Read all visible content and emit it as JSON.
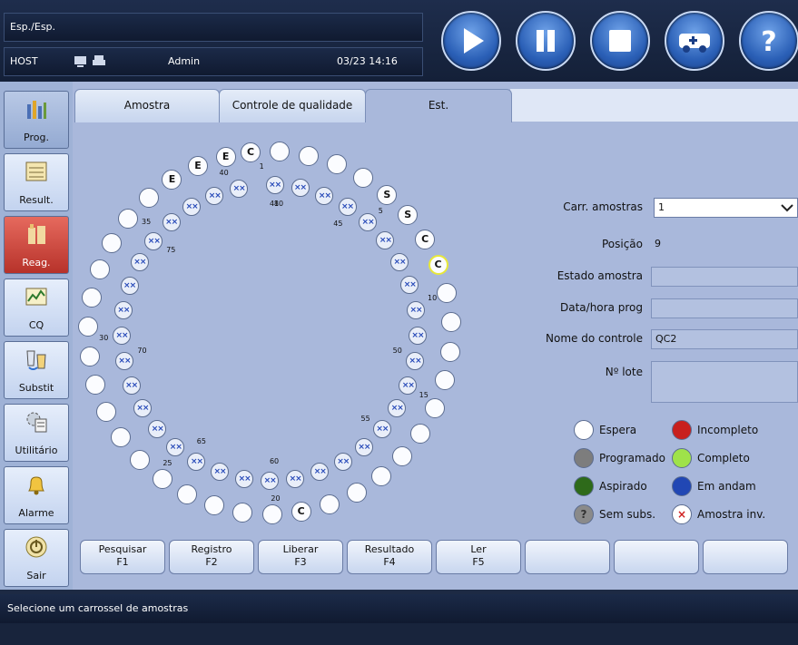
{
  "header": {
    "mode": "Esp./Esp.",
    "host": "HOST",
    "user": "Admin",
    "datetime": "03/23 14:16"
  },
  "toolbar": {
    "buttons": [
      "play-icon",
      "pause-icon",
      "stop-icon",
      "ambulance-icon",
      "help-icon"
    ]
  },
  "nav": {
    "items": [
      {
        "label": "Prog.",
        "icon": "bar-chart-icon"
      },
      {
        "label": "Result.",
        "icon": "results-sheet-icon"
      },
      {
        "label": "Reag.",
        "icon": "reagent-bottle-icon"
      },
      {
        "label": "CQ",
        "icon": "qc-graph-icon"
      },
      {
        "label": "Substit",
        "icon": "substitute-cup-icon"
      },
      {
        "label": "Utilitário",
        "icon": "utility-gear-icon"
      },
      {
        "label": "Alarme",
        "icon": "alarm-bell-icon"
      },
      {
        "label": "Sair",
        "icon": "power-icon"
      }
    ]
  },
  "tabs": [
    "Amostra",
    "Controle de qualidade",
    "Est."
  ],
  "carousel": {
    "outer": [
      {
        "text": "C",
        "hl": false
      },
      {
        "text": "",
        "hl": false
      },
      {
        "text": "",
        "hl": false
      },
      {
        "text": "",
        "hl": false
      },
      {
        "text": "",
        "hl": false
      },
      {
        "text": "S",
        "hl": false
      },
      {
        "text": "S",
        "hl": false
      },
      {
        "text": "C",
        "hl": false
      },
      {
        "text": "C",
        "hl": true
      },
      {
        "text": "",
        "hl": false
      },
      {
        "text": "",
        "hl": false
      },
      {
        "text": "",
        "hl": false
      },
      {
        "text": "",
        "hl": false
      },
      {
        "text": "",
        "hl": false
      },
      {
        "text": "",
        "hl": false
      },
      {
        "text": "",
        "hl": false
      },
      {
        "text": "",
        "hl": false
      },
      {
        "text": "",
        "hl": false
      },
      {
        "text": "",
        "hl": false
      },
      {
        "text": "C",
        "hl": false
      },
      {
        "text": "",
        "hl": false
      },
      {
        "text": "",
        "hl": false
      },
      {
        "text": "",
        "hl": false
      },
      {
        "text": "",
        "hl": false
      },
      {
        "text": "",
        "hl": false
      },
      {
        "text": "",
        "hl": false
      },
      {
        "text": "",
        "hl": false
      },
      {
        "text": "",
        "hl": false
      },
      {
        "text": "",
        "hl": false
      },
      {
        "text": "",
        "hl": false
      },
      {
        "text": "",
        "hl": false
      },
      {
        "text": "",
        "hl": false
      },
      {
        "text": "",
        "hl": false
      },
      {
        "text": "",
        "hl": false
      },
      {
        "text": "",
        "hl": false
      },
      {
        "text": "",
        "hl": false
      },
      {
        "text": "E",
        "hl": false
      },
      {
        "text": "E",
        "hl": false
      },
      {
        "text": "E",
        "hl": false
      }
    ],
    "inner_mark": "××",
    "numbers": [
      "1",
      "5",
      "10",
      "15",
      "20",
      "25",
      "30",
      "35",
      "40",
      "41",
      "45",
      "50",
      "55",
      "60",
      "65",
      "70",
      "75",
      "80"
    ]
  },
  "fields": {
    "carr_label": "Carr. amostras",
    "carr_value": "1",
    "posicao_label": "Posição",
    "posicao_value": "9",
    "estado_label": "Estado amostra",
    "estado_value": "",
    "data_label": "Data/hora prog",
    "data_value": "",
    "nome_label": "Nome do controle",
    "nome_value": "QC2",
    "lote_label": "Nº lote",
    "lote_value": ""
  },
  "legend": {
    "espera": "Espera",
    "incompleto": "Incompleto",
    "programado": "Programado",
    "completo": "Completo",
    "aspirado": "Aspirado",
    "em_andam": "Em andam",
    "sem_subs": "Sem subs.",
    "sem_subs_mark": "?",
    "amostra_inv": "Amostra inv.",
    "amostra_inv_mark": "×",
    "colors": {
      "espera": "#ffffff",
      "incompleto": "#c8201e",
      "programado": "#7d7d7d",
      "completo": "#9fe24a",
      "aspirado": "#2e6a1a",
      "em_andam": "#2147b4",
      "sem_subs": "#8a8a8a"
    }
  },
  "function_buttons": [
    {
      "label": "Pesquisar",
      "key": "F1"
    },
    {
      "label": "Registro",
      "key": "F2"
    },
    {
      "label": "Liberar",
      "key": "F3"
    },
    {
      "label": "Resultado",
      "key": "F4"
    },
    {
      "label": "Ler",
      "key": "F5"
    },
    {
      "label": "",
      "key": ""
    },
    {
      "label": "",
      "key": ""
    },
    {
      "label": "",
      "key": ""
    }
  ],
  "status_message": "Selecione um carrossel de amostras"
}
